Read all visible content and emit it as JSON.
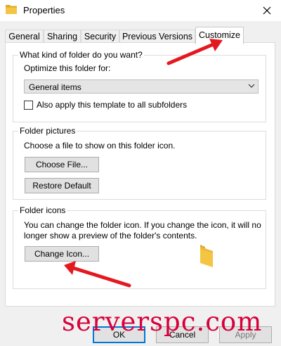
{
  "window": {
    "title": "Properties",
    "close_icon": "close-icon",
    "title_icon": "folder-icon"
  },
  "tabs": [
    {
      "label": "General"
    },
    {
      "label": "Sharing"
    },
    {
      "label": "Security"
    },
    {
      "label": "Previous Versions"
    },
    {
      "label": "Customize",
      "active": true
    }
  ],
  "folder_type_group": {
    "label": "What kind of folder do you want?",
    "optimize_label": "Optimize this folder for:",
    "dropdown_value": "General items",
    "apply_checkbox_label": "Also apply this template to all subfolders",
    "apply_checked": false
  },
  "folder_pictures_group": {
    "label": "Folder pictures",
    "description": "Choose a file to show on this folder icon.",
    "choose_file_button": "Choose File...",
    "restore_default_button": "Restore Default"
  },
  "folder_icons_group": {
    "label": "Folder icons",
    "description_line1": "You can change the folder icon. If you change the icon, it will no",
    "description_line2": "longer show a preview of the folder's contents.",
    "change_icon_button": "Change Icon..."
  },
  "bottom_buttons": {
    "ok": "OK",
    "cancel": "Cancel",
    "apply": "Apply"
  },
  "watermark": "serverspc.com",
  "colors": {
    "accent_blue": "#0078d7",
    "annotation_red": "#e3191f",
    "folder_yellow": "#f4c542"
  }
}
